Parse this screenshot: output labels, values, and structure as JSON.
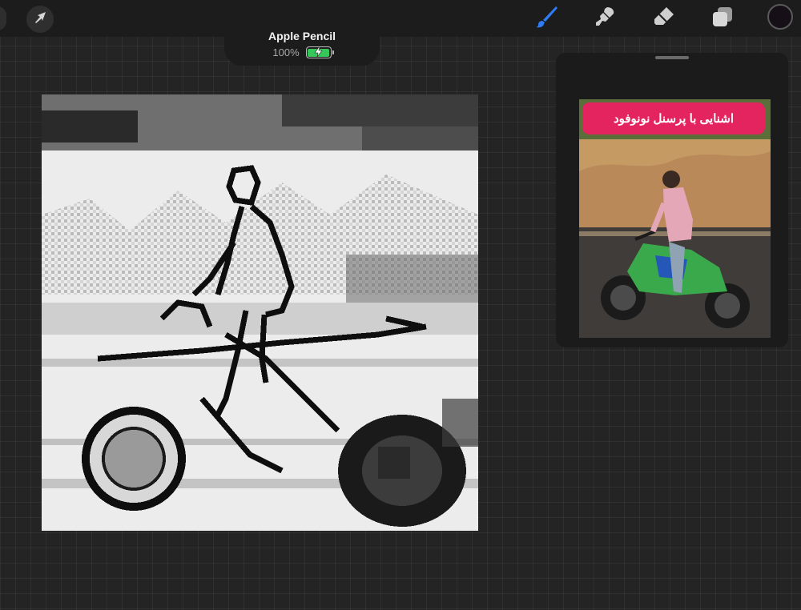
{
  "toolbar": {
    "transform_icon": "arrow-cursor-icon",
    "tools": [
      {
        "name": "brush",
        "icon": "brush-icon",
        "active": true
      },
      {
        "name": "smudge",
        "icon": "smudge-icon",
        "active": false
      },
      {
        "name": "eraser",
        "icon": "eraser-icon",
        "active": false
      },
      {
        "name": "layers",
        "icon": "layers-icon",
        "active": false
      }
    ],
    "active_color": "#160f18",
    "accent": "#2f7cf6"
  },
  "pencil_status": {
    "device_name": "Apple Pencil",
    "battery_percent_label": "100%",
    "battery_level": 1.0,
    "charging": true
  },
  "canvas": {
    "background": "#f2f2f2",
    "content": "pixelated black-and-white drawing"
  },
  "reference": {
    "banner_text": "اشنایی با پرسنل نونوفود",
    "banner_color": "#e3245e"
  }
}
